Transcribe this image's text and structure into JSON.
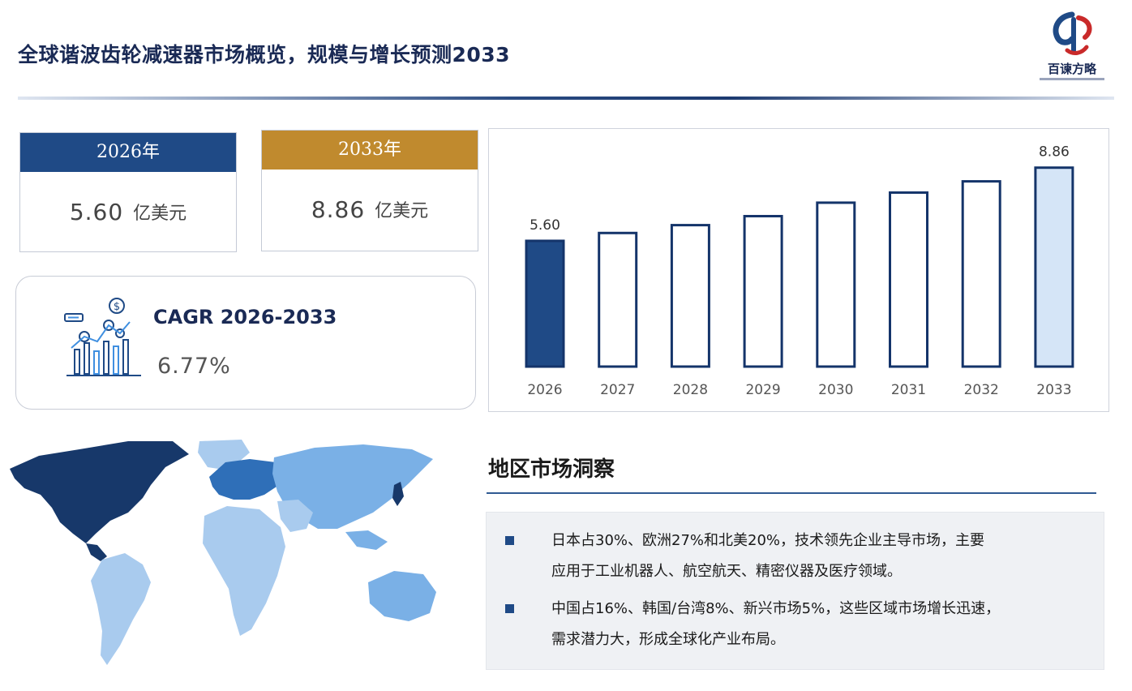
{
  "page": {
    "title": "全球谐波齿轮减速器市场概览，规模与增长预测2033",
    "logo_text": "百谏方略"
  },
  "kpi": [
    {
      "year": "2026年",
      "value": "5.60",
      "unit": "亿美元",
      "color": "#1f4a86"
    },
    {
      "year": "2033年",
      "value": "8.86",
      "unit": "亿美元",
      "color": "#c08a2e"
    }
  ],
  "cagr": {
    "label": "CAGR 2026-2033",
    "value": "6.77%",
    "icon": "chart-dollar-icon"
  },
  "chart_data": {
    "type": "bar",
    "categories": [
      "2026",
      "2027",
      "2028",
      "2029",
      "2030",
      "2031",
      "2032",
      "2033"
    ],
    "values": [
      5.6,
      5.95,
      6.3,
      6.7,
      7.3,
      7.75,
      8.25,
      8.86
    ],
    "value_labels": [
      "5.60",
      "",
      "",
      "",
      "",
      "",
      "",
      "8.86"
    ],
    "ylim": [
      0,
      9.5
    ],
    "title": "",
    "xlabel": "",
    "ylabel": "",
    "grid": false,
    "colors": {
      "first": "#1f4a86",
      "last": "#d5e5f7",
      "default": "#ffffff",
      "stroke": "#14346a"
    }
  },
  "region": {
    "title": "地区市场洞察",
    "insights": [
      {
        "lines": [
          "日本占30%、欧洲27%和北美20%，技术领先企业主导市场，主要",
          "应用于工业机器人、航空航天、精密仪器及医疗领域。"
        ]
      },
      {
        "lines": [
          "中国占16%、韩国/台湾8%、新兴市场5%，这些区域市场增长迅速，",
          "需求潜力大，形成全球化产业布局。"
        ]
      }
    ]
  }
}
